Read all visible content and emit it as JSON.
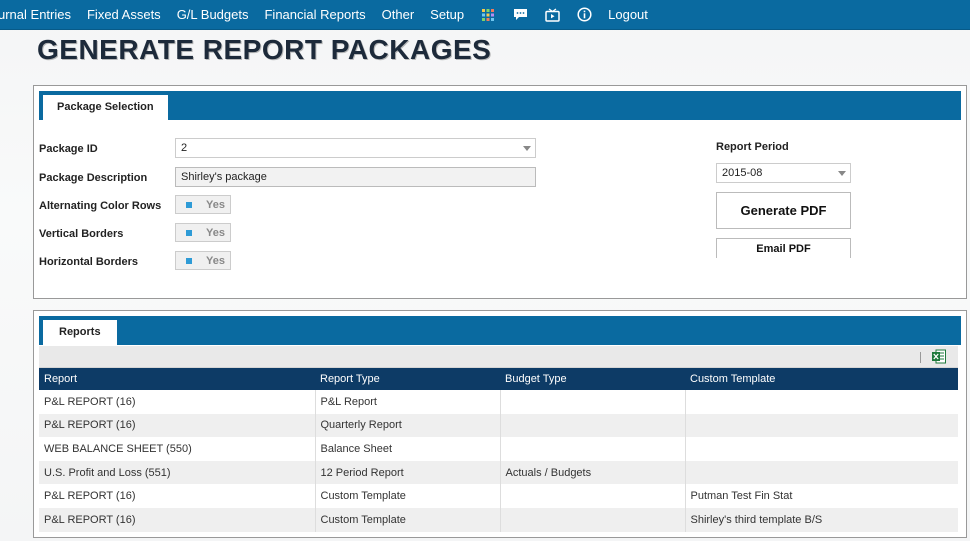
{
  "nav": {
    "items": [
      "urnal Entries",
      "Fixed Assets",
      "G/L Budgets",
      "Financial Reports",
      "Other",
      "Setup"
    ],
    "icons": [
      "grid-icon",
      "chat-icon",
      "tv-icon",
      "info-icon"
    ],
    "logout": "Logout"
  },
  "page_title": "GENERATE REPORT PACKAGES",
  "package_panel": {
    "tab": "Package Selection",
    "package_id_label": "Package ID",
    "package_id_value": "2",
    "package_desc_label": "Package Description",
    "package_desc_value": "Shirley's package",
    "alt_rows_label": "Alternating Color Rows",
    "alt_rows_value": "Yes",
    "vert_borders_label": "Vertical Borders",
    "vert_borders_value": "Yes",
    "horiz_borders_label": "Horizontal Borders",
    "horiz_borders_value": "Yes",
    "report_period_label": "Report Period",
    "report_period_value": "2015-08",
    "generate_pdf": "Generate PDF",
    "email_pdf": "Email PDF"
  },
  "reports_panel": {
    "tab": "Reports",
    "columns": [
      "Report",
      "Report Type",
      "Budget Type",
      "Custom Template"
    ],
    "rows": [
      [
        "P&L REPORT (16)",
        "P&L Report",
        "",
        ""
      ],
      [
        "P&L REPORT (16)",
        "Quarterly Report",
        "",
        ""
      ],
      [
        "WEB BALANCE SHEET (550)",
        "Balance Sheet",
        "",
        ""
      ],
      [
        "U.S. Profit and Loss (551)",
        "12 Period Report",
        "Actuals / Budgets",
        ""
      ],
      [
        "P&L REPORT (16)",
        "Custom Template",
        "",
        "Putman Test Fin Stat"
      ],
      [
        "P&L REPORT (16)",
        "Custom Template",
        "",
        "Shirley's third template B/S"
      ]
    ]
  },
  "colors": {
    "nav_bg": "#0a6aa0",
    "header_bg": "#0a6aa0",
    "table_header": "#0d3b66",
    "toggle_accent": "#2e9bd6",
    "excel_green": "#1e7a3c"
  }
}
